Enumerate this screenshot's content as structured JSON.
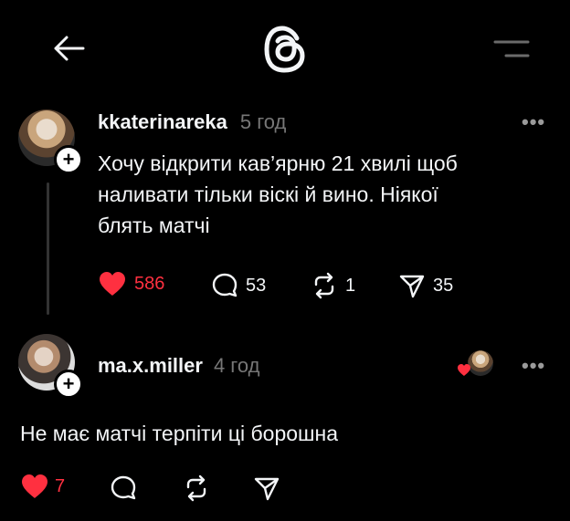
{
  "header": {
    "back_icon": "arrow-left-icon",
    "logo_icon": "threads-logo-icon",
    "menu_icon": "menu-icon"
  },
  "post": {
    "username": "kkaterinareka",
    "time": "5 год",
    "text_line1": "Хочу відкрити кав’ярню 21 хвилі щоб",
    "text_line2": "наливати тільки віскі й вино. Ніякої",
    "text_line3": "блять матчі",
    "likes": "586",
    "replies": "53",
    "reposts": "1",
    "shares": "35",
    "like_color": "#ff3040"
  },
  "reply": {
    "username": "ma.x.miller",
    "time": "4 год",
    "text": "Не має матчі терпіти ці борошна",
    "likes": "7"
  }
}
